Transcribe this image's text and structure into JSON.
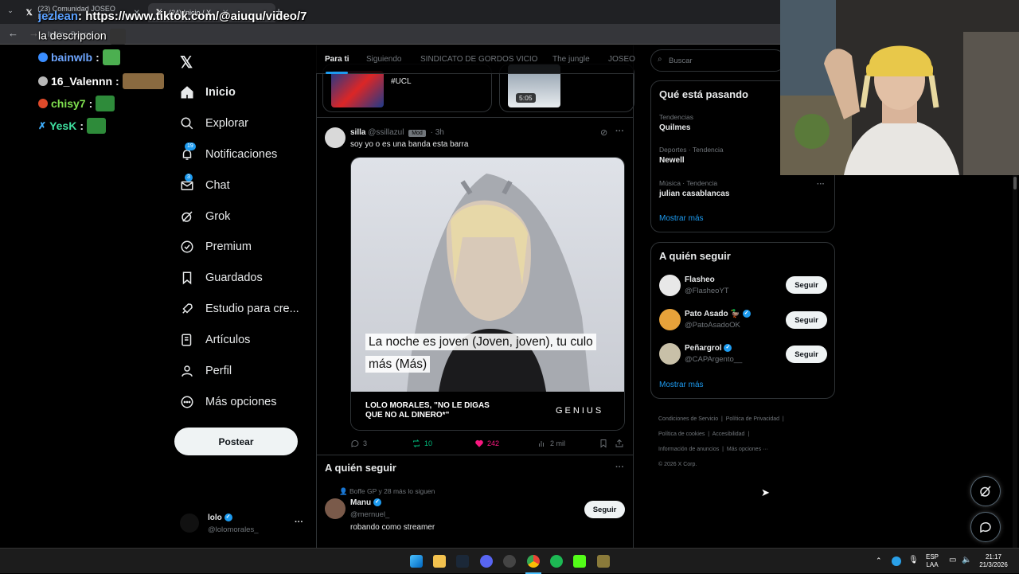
{
  "browser": {
    "tabs": [
      {
        "label": "(23) Comunidad JOSEO EXCLU..."
      },
      {
        "label": "(24) Inicio / X"
      }
    ],
    "address_hint": "Inicio · Buscar..."
  },
  "stream_overlay": {
    "top_message_user": "jezlean",
    "top_message_text": ": https://www.tiktok.com/@aiuqu/video/7",
    "second_line": "la descripcion",
    "chat": [
      {
        "user": "bainwlb",
        "color": "#5a8dff"
      },
      {
        "user": "16_Valennn",
        "color": "#ffffff"
      },
      {
        "user": "chisy7",
        "color": "#7fe04f"
      },
      {
        "user": "YesK",
        "color": "#3fe0a0"
      }
    ]
  },
  "x_nav": {
    "items": [
      {
        "label": "Inicio",
        "icon": "home-icon"
      },
      {
        "label": "Explorar",
        "icon": "search-icon"
      },
      {
        "label": "Notificaciones",
        "icon": "bell-icon",
        "badge": "19"
      },
      {
        "label": "Chat",
        "icon": "mail-icon",
        "badge": "3"
      },
      {
        "label": "Grok",
        "icon": "grok-icon"
      },
      {
        "label": "Premium",
        "icon": "premium-icon"
      },
      {
        "label": "Guardados",
        "icon": "bookmark-icon"
      },
      {
        "label": "Estudio para cre...",
        "icon": "rocket-icon"
      },
      {
        "label": "Artículos",
        "icon": "articles-icon"
      },
      {
        "label": "Perfil",
        "icon": "person-icon"
      },
      {
        "label": "Más opciones",
        "icon": "more-circle-icon"
      }
    ],
    "post_button": "Postear",
    "account": {
      "name": "lolo",
      "handle": "@lolomorales_"
    }
  },
  "feed": {
    "tabs": [
      "Para ti",
      "Siguiendo",
      "SINDICATO DE GORDOS VICIO",
      "The jungle",
      "JOSEO"
    ],
    "prev_card": {
      "hashtag": "#UCL",
      "video_time": "5:05"
    },
    "post": {
      "author": "silla",
      "handle": "@ssillazul",
      "role_badge": "Mod",
      "time": "3h",
      "text": "soy yo o es una banda esta barra",
      "lyric": "La noche es joven (Joven, joven), tu culo más (Más)",
      "caption_title": "LOLO MORALES, \"NO LE DIGAS QUE NO AL DINERO*\"",
      "caption_brand": "GENIUS",
      "replies": "3",
      "reposts": "10",
      "likes": "242",
      "views": "2 mil"
    },
    "who_to_follow": {
      "title": "A quién seguir",
      "context": "Boffe GP y 28 más lo siguen",
      "name": "Manu",
      "handle": "@mernuel_",
      "bio": "robando como streamer",
      "button": "Seguir"
    }
  },
  "right": {
    "search_placeholder": "Buscar",
    "trends_title": "Qué está pasando",
    "trends": [
      {
        "meta": "Tendencias",
        "name": "Quilmes"
      },
      {
        "meta": "Deportes · Tendencia",
        "name": "Newell"
      },
      {
        "meta": "Música · Tendencia",
        "name": "julian casablancas"
      }
    ],
    "show_more": "Mostrar más",
    "follow_title": "A quién seguir",
    "follow": [
      {
        "name": "Flasheo",
        "handle": "@FlasheoYT",
        "verified": false,
        "button": "Seguir"
      },
      {
        "name": "Pato Asado 🦆",
        "handle": "@PatoAsadoOK",
        "verified": true,
        "button": "Seguir"
      },
      {
        "name": "Peñargrol",
        "handle": "@CAPArgento__",
        "verified": true,
        "button": "Seguir"
      }
    ],
    "show_more2": "Mostrar más",
    "footer": [
      "Condiciones de Servicio",
      "Política de Privacidad",
      "Política de cookies",
      "Accesibilidad",
      "Información de anuncios",
      "Más opciones ···",
      "© 2026 X Corp."
    ]
  },
  "taskbar": {
    "lang_top": "ESP",
    "lang_bottom": "LAA",
    "time": "21:17",
    "date": "21/3/2026"
  }
}
